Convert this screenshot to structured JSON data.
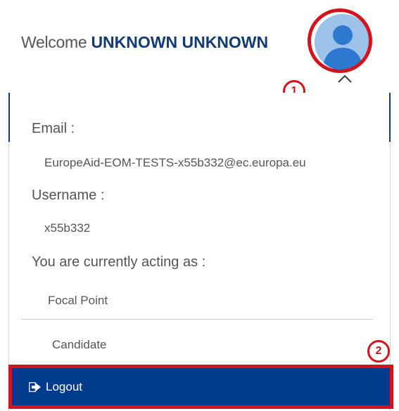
{
  "header": {
    "welcome_prefix": "Welcome",
    "user_name": "UNKNOWN UNKNOWN",
    "avatar_icon": "user-avatar-icon",
    "toggle_icon": "chevron-up-icon"
  },
  "user_menu": {
    "email_label": "Email :",
    "email_value": "EuropeAid-EOM-TESTS-x55b332@ec.europa.eu",
    "username_label": "Username :",
    "username_value": "x55b332",
    "acting_as_label": "You are currently acting as :",
    "roles": [
      {
        "label": "Focal Point"
      },
      {
        "label": "Candidate"
      }
    ],
    "logout_label": "Logout",
    "logout_icon": "sign-out-icon"
  },
  "annotations": {
    "callout_1": "1",
    "callout_2": "2"
  },
  "colors": {
    "brand_blue": "#003b8e",
    "name_blue": "#123a75",
    "annotation_red": "#d4141c",
    "avatar_blue": "#9cc2ea"
  }
}
